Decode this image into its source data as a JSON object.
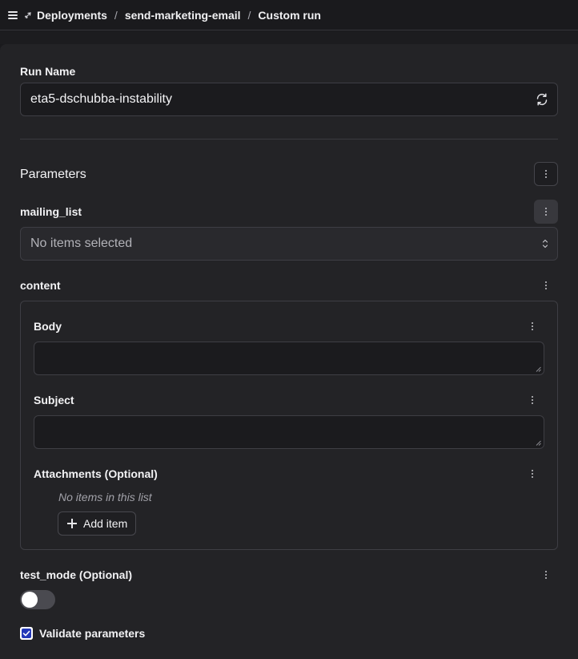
{
  "breadcrumb": {
    "items": [
      "Deployments",
      "send-marketing-email",
      "Custom run"
    ],
    "separator": "/"
  },
  "form": {
    "run_name": {
      "label": "Run Name",
      "value": "eta5-dschubba-instability"
    },
    "parameters_title": "Parameters",
    "mailing_list": {
      "label": "mailing_list",
      "placeholder": "No items selected"
    },
    "content": {
      "label": "content",
      "body_label": "Body",
      "body_value": "",
      "subject_label": "Subject",
      "subject_value": "",
      "attachments_label": "Attachments (Optional)",
      "attachments_empty": "No items in this list",
      "add_item_label": "Add item"
    },
    "test_mode": {
      "label": "test_mode (Optional)",
      "enabled": false
    },
    "validate": {
      "label": "Validate parameters",
      "checked": true
    }
  },
  "icons": {
    "menu": "hamburger-menu-icon",
    "deployment": "rocket-icon",
    "refresh": "refresh-icon",
    "more": "kebab-menu-icon",
    "select": "chevron-up-down-icon",
    "add": "plus-icon",
    "check": "checkmark-icon"
  },
  "colors": {
    "background": "#1a1a1d",
    "panel": "#232326",
    "checkbox_accent": "#2438b8",
    "toggle_off": "#4a4a50"
  }
}
